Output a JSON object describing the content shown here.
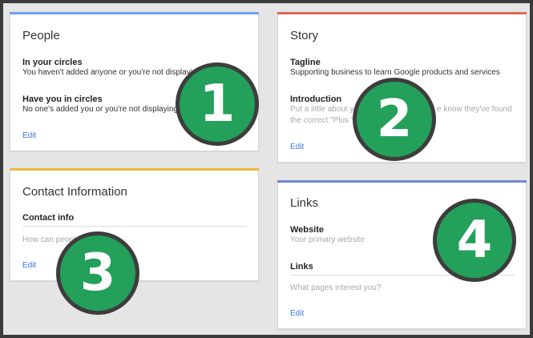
{
  "colors": {
    "people_accent": "#6ea0f0",
    "story_accent": "#dd6a58",
    "contact_accent": "#f4b73a",
    "links_accent": "#6f86cc",
    "badge_fill": "#23a05a",
    "link_blue": "#3b78e7"
  },
  "people": {
    "title": "People",
    "in_circles_label": "In your circles",
    "in_circles_text": "You haven't added anyone or you're not displaying",
    "have_you_label": "Have you in circles",
    "have_you_text": "No one's added you or you're not displaying",
    "edit_label": "Edit"
  },
  "story": {
    "title": "Story",
    "tagline_label": "Tagline",
    "tagline_text": "Supporting business to learn Google products and services",
    "intro_label": "Introduction",
    "intro_line1": "Put a little about y",
    "intro_line1b": "e know they've found",
    "intro_line2": "the correct \"Plus Y",
    "edit_label": "Edit"
  },
  "contact": {
    "title": "Contact Information",
    "info_label": "Contact info",
    "info_placeholder": "How can peopl",
    "edit_label": "Edit"
  },
  "links": {
    "title": "Links",
    "website_label": "Website",
    "website_placeholder": "Your primary website",
    "links_label": "Links",
    "links_placeholder": "What pages interest you?",
    "edit_label": "Edit"
  },
  "badges": [
    "1",
    "2",
    "3",
    "4"
  ]
}
